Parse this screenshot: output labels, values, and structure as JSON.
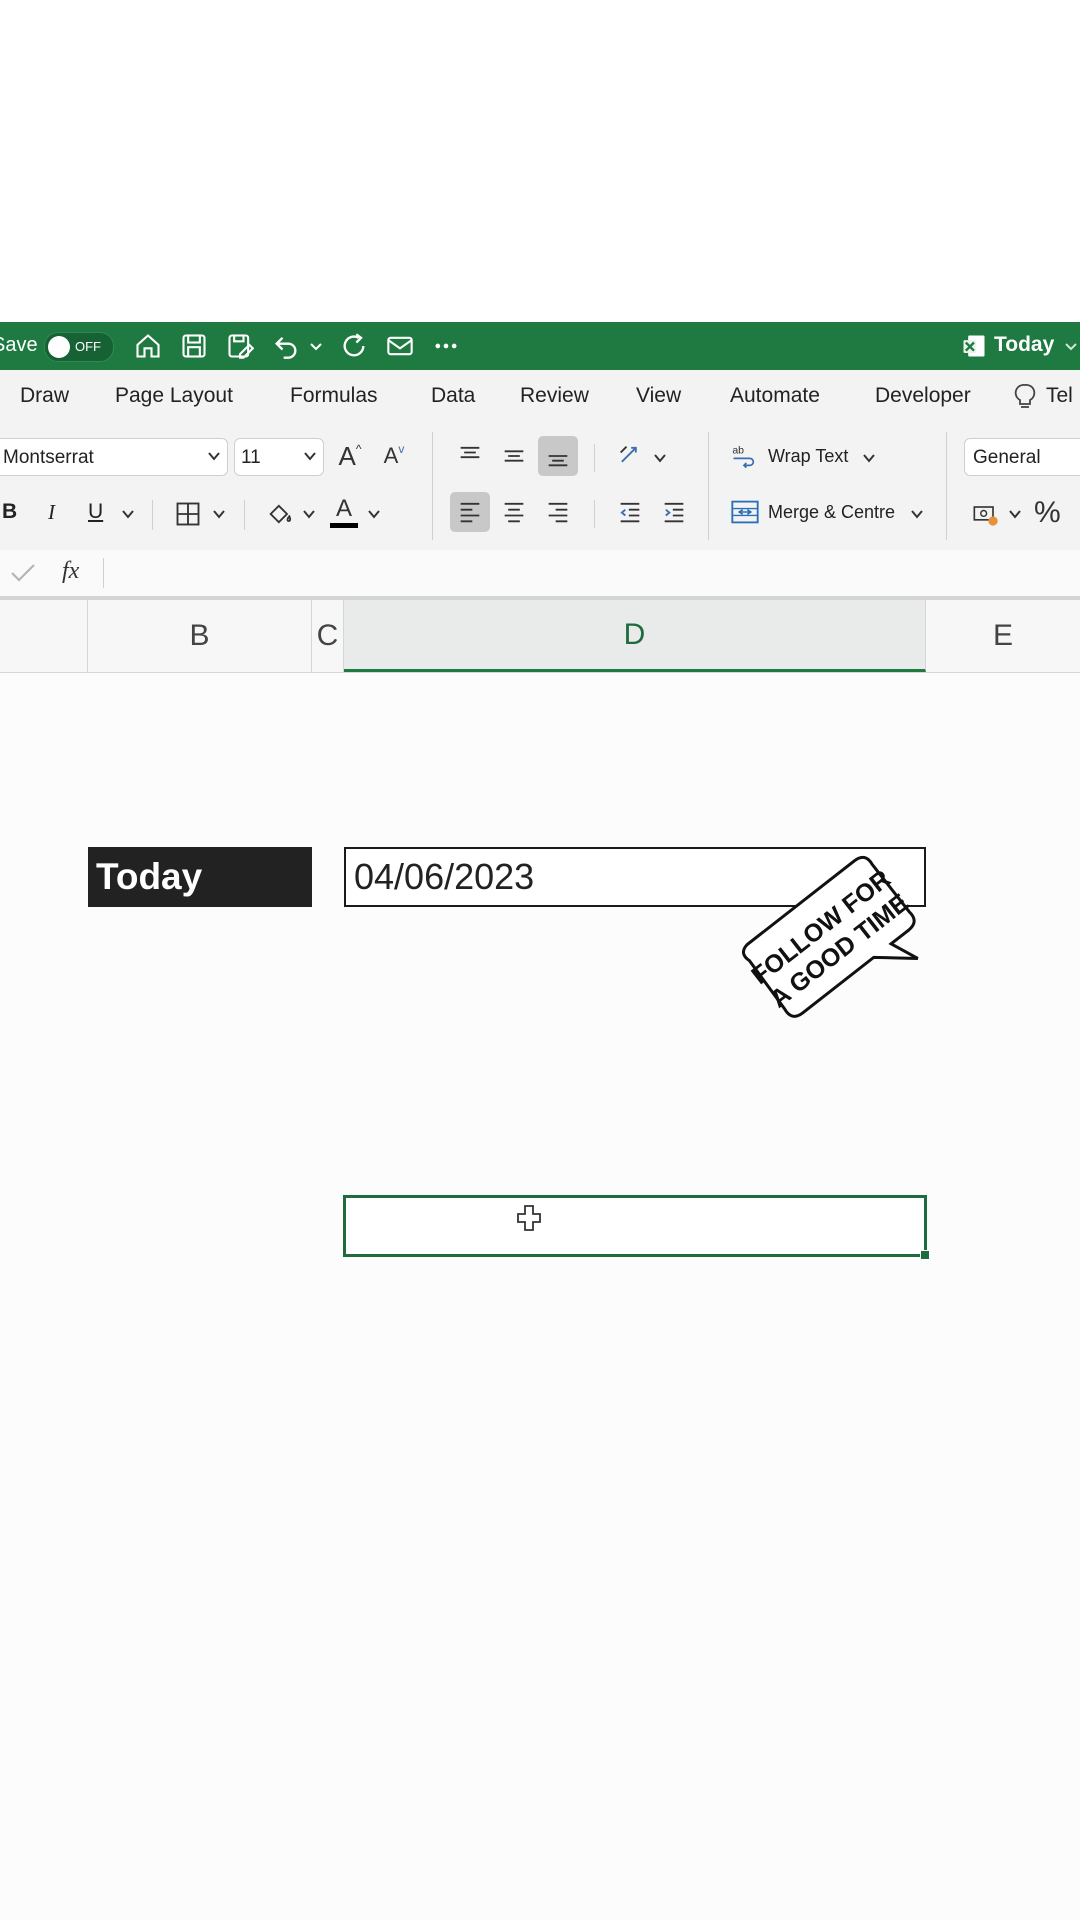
{
  "titlebar": {
    "autosave_label": "Save",
    "toggle_label": "OFF",
    "document_title": "Today"
  },
  "tabs": [
    "Draw",
    "Page Layout",
    "Formulas",
    "Data",
    "Review",
    "View",
    "Automate",
    "Developer",
    "Tel"
  ],
  "ribbon": {
    "font_name": "Montserrat",
    "font_size": "11",
    "wrap_text_label": "Wrap Text",
    "merge_label": "Merge & Centre",
    "number_format": "General",
    "percent_label": "%",
    "bold_label": "B",
    "italic_label": "I",
    "underline_label": "U",
    "grow_font_label": "A",
    "shrink_font_label": "A",
    "font_color_label": "A"
  },
  "formula_bar": {
    "fx_label": "fx",
    "value": ""
  },
  "columns": [
    "B",
    "C",
    "D",
    "E"
  ],
  "selected_column": "D",
  "cells": {
    "label": "Today",
    "date_value": "04/06/2023",
    "active_value": ""
  },
  "sticker": {
    "line1": "FOLLOW FOR",
    "line2": "A GOOD TIME"
  },
  "colors": {
    "excel_green": "#1e7a41",
    "selection_green": "#1e6b3d",
    "label_bg": "#222222"
  }
}
